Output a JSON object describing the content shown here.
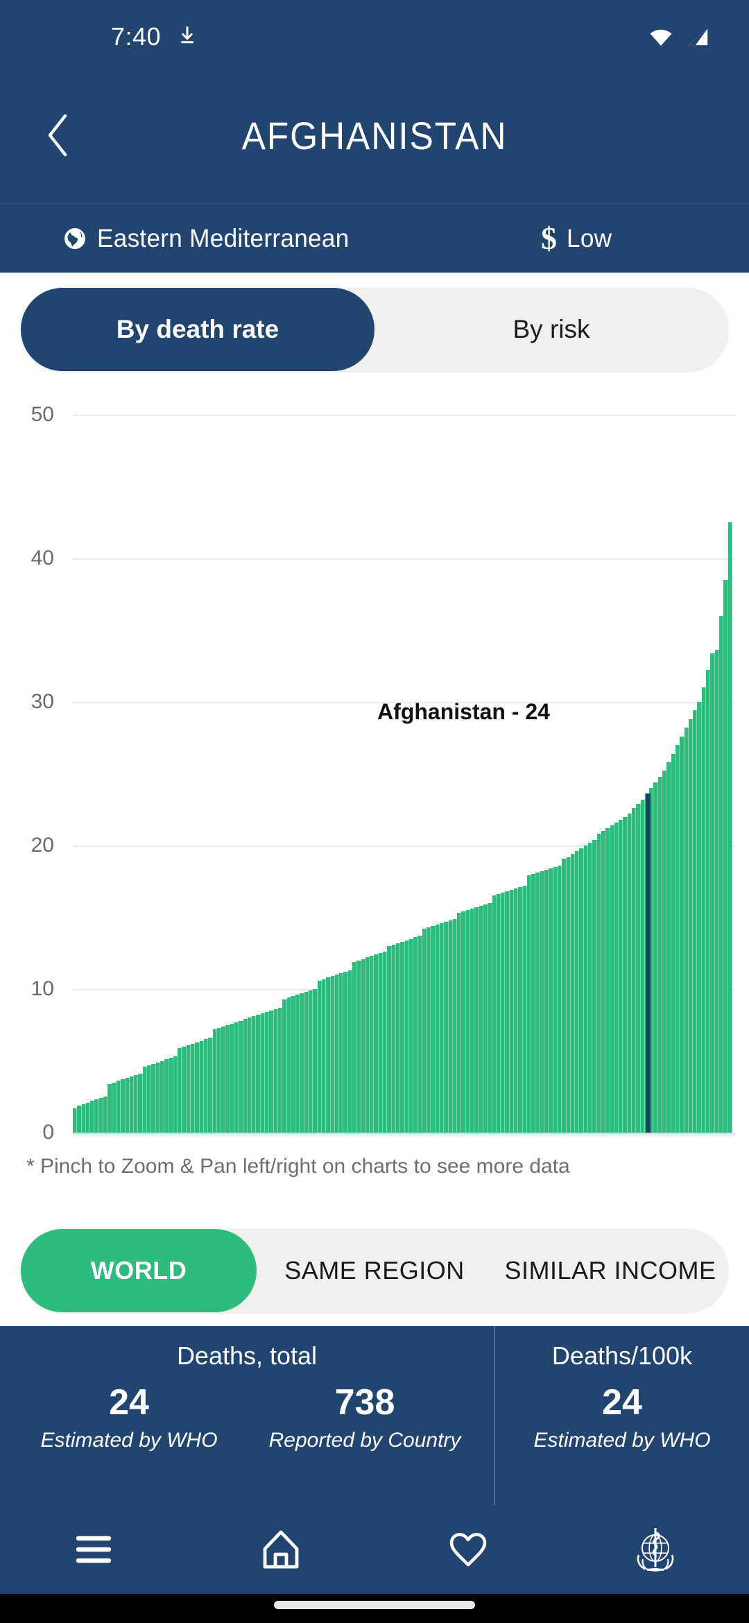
{
  "status_bar": {
    "time": "7:40",
    "download_icon": "download-icon",
    "wifi_icon": "wifi-icon",
    "signal_icon": "cellular-signal-icon"
  },
  "app_bar": {
    "back_icon": "chevron-left-icon",
    "title": "AFGHANISTAN"
  },
  "meta": {
    "region_icon": "globe-icon",
    "region": "Eastern Mediterranean",
    "income_icon": "dollar-icon",
    "income": "Low"
  },
  "chart_tabs": {
    "items": [
      {
        "label": "By death rate",
        "active": true
      },
      {
        "label": "By risk",
        "active": false
      }
    ]
  },
  "scope_tabs": {
    "items": [
      {
        "label": "WORLD",
        "active": true
      },
      {
        "label": "SAME REGION",
        "active": false
      },
      {
        "label": "SIMILAR INCOME",
        "active": false
      }
    ]
  },
  "chart_note": "* Pinch to Zoom & Pan left/right on charts to see more data",
  "stats": {
    "groups": [
      {
        "heading": "Deaths, total",
        "columns": [
          {
            "value": "24",
            "caption": "Estimated by WHO"
          },
          {
            "value": "738",
            "caption": "Reported by Country"
          }
        ]
      },
      {
        "heading": "Deaths/100k",
        "columns": [
          {
            "value": "24",
            "caption": "Estimated by WHO"
          }
        ]
      }
    ]
  },
  "bottom_nav": {
    "items": [
      {
        "icon": "hamburger-menu-icon",
        "name": "menu"
      },
      {
        "icon": "home-icon",
        "name": "home"
      },
      {
        "icon": "heart-icon",
        "name": "favorites"
      },
      {
        "icon": "who-logo-icon",
        "name": "who"
      }
    ]
  },
  "colors": {
    "brand_blue": "#21456f",
    "accent_green": "#2ebc7d",
    "marker_blue": "#1f3f66",
    "segment_track": "#f0f0f1"
  },
  "chart_data": {
    "type": "bar",
    "title": "",
    "xlabel": "",
    "ylabel": "",
    "ylim": [
      0,
      50
    ],
    "yticks": [
      0,
      10,
      20,
      30,
      40,
      50
    ],
    "grid": true,
    "legend": null,
    "sorted": "ascending",
    "highlight": {
      "label": "Afghanistan - 24",
      "country": "Afghanistan",
      "value": 24,
      "index": 131
    },
    "series_name": "Deaths/100k",
    "values": [
      1.7,
      1.9,
      2.0,
      2.1,
      2.2,
      2.3,
      2.4,
      2.5,
      3.4,
      3.5,
      3.6,
      3.7,
      3.8,
      3.9,
      4.0,
      4.1,
      4.6,
      4.7,
      4.8,
      4.9,
      5.0,
      5.1,
      5.2,
      5.3,
      5.9,
      6.0,
      6.1,
      6.2,
      6.3,
      6.4,
      6.5,
      6.6,
      7.2,
      7.3,
      7.4,
      7.5,
      7.6,
      7.7,
      7.8,
      7.9,
      8.0,
      8.1,
      8.2,
      8.3,
      8.4,
      8.5,
      8.6,
      8.7,
      9.3,
      9.4,
      9.5,
      9.6,
      9.7,
      9.8,
      9.9,
      10.0,
      10.6,
      10.7,
      10.8,
      10.9,
      11.0,
      11.1,
      11.2,
      11.3,
      11.9,
      12.0,
      12.1,
      12.2,
      12.3,
      12.4,
      12.5,
      12.6,
      13.0,
      13.1,
      13.2,
      13.3,
      13.4,
      13.5,
      13.6,
      13.7,
      14.2,
      14.3,
      14.4,
      14.5,
      14.6,
      14.7,
      14.8,
      14.9,
      15.3,
      15.4,
      15.5,
      15.6,
      15.7,
      15.8,
      15.9,
      16.0,
      16.5,
      16.6,
      16.7,
      16.8,
      16.9,
      17.0,
      17.1,
      17.2,
      17.9,
      18.0,
      18.1,
      18.2,
      18.3,
      18.4,
      18.5,
      18.6,
      19.1,
      19.2,
      19.4,
      19.6,
      19.8,
      20.0,
      20.2,
      20.4,
      20.8,
      21.0,
      21.2,
      21.4,
      21.6,
      21.8,
      22.0,
      22.2,
      22.6,
      22.9,
      23.2,
      23.6,
      24.0,
      24.4,
      24.8,
      25.2,
      25.8,
      26.4,
      27.0,
      27.6,
      28.2,
      28.8,
      29.4,
      30.0,
      31.0,
      32.2,
      33.4,
      33.6,
      36.0,
      38.5,
      42.5
    ]
  }
}
